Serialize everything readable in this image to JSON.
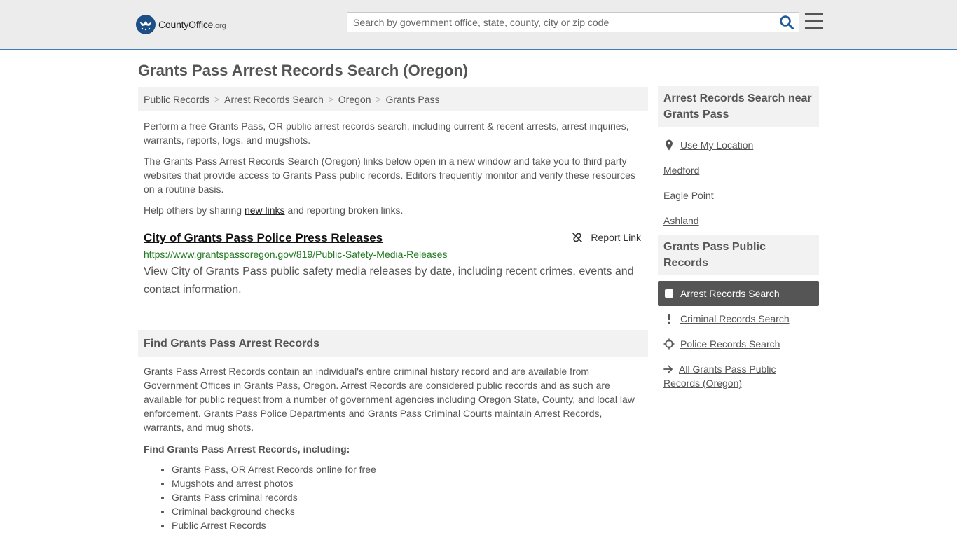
{
  "header": {
    "logo_main": "CountyOffice",
    "logo_suffix": ".org",
    "search_placeholder": "Search by government office, state, county, city or zip code"
  },
  "page_title": "Grants Pass Arrest Records Search (Oregon)",
  "breadcrumb": [
    "Public Records",
    "Arrest Records Search",
    "Oregon",
    "Grants Pass"
  ],
  "intro": {
    "p1": "Perform a free Grants Pass, OR public arrest records search, including current & recent arrests, arrest inquiries, warrants, reports, logs, and mugshots.",
    "p2": "The Grants Pass Arrest Records Search (Oregon) links below open in a new window and take you to third party websites that provide access to Grants Pass public records. Editors frequently monitor and verify these resources on a routine basis.",
    "p3_before": "Help others by sharing ",
    "p3_link": "new links",
    "p3_after": " and reporting broken links."
  },
  "result": {
    "title": "City of Grants Pass Police Press Releases",
    "report_label": "Report Link",
    "url": "https://www.grantspassoregon.gov/819/Public-Safety-Media-Releases",
    "description": "View City of Grants Pass public safety media releases by date, including recent crimes, events and contact information."
  },
  "find_section": {
    "heading": "Find Grants Pass Arrest Records",
    "body": "Grants Pass Arrest Records contain an individual's entire criminal history record and are available from Government Offices in Grants Pass, Oregon. Arrest Records are considered public records and as such are available for public request from a number of government agencies including Oregon State, County, and local law enforcement. Grants Pass Police Departments and Grants Pass Criminal Courts maintain Arrest Records, warrants, and mug shots.",
    "sub_heading": "Find Grants Pass Arrest Records, including:",
    "bullets": [
      "Grants Pass, OR Arrest Records online for free",
      "Mugshots and arrest photos",
      "Grants Pass criminal records",
      "Criminal background checks",
      "Public Arrest Records"
    ]
  },
  "sidebar": {
    "near_heading": "Arrest Records Search near Grants Pass",
    "use_location": "Use My Location",
    "near": [
      "Medford",
      "Eagle Point",
      "Ashland"
    ],
    "public_heading": "Grants Pass Public Records",
    "public_links": [
      {
        "label": "Arrest Records Search",
        "icon": "square-icon"
      },
      {
        "label": "Criminal Records Search",
        "icon": "exclamation-icon"
      },
      {
        "label": "Police Records Search",
        "icon": "crosshair-icon"
      },
      {
        "label": "All Grants Pass Public Records (Oregon)",
        "icon": "arrow-right-icon"
      }
    ]
  },
  "colors": {
    "header_bg": "#ececec",
    "header_border": "#3f7fbf",
    "url_green": "#1e7a1e",
    "active_bg": "#555555"
  }
}
